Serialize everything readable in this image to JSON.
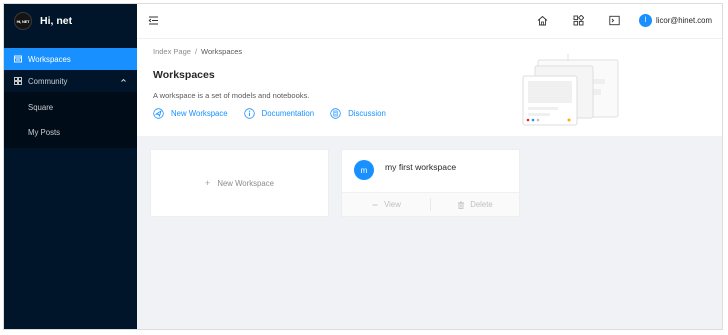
{
  "app": {
    "logo_badge": "Hi, NET",
    "logo_text": "Hi, net"
  },
  "sidebar": {
    "items": [
      {
        "label": "Workspaces",
        "icon": "workspace-icon",
        "active": true
      },
      {
        "label": "Community",
        "icon": "community-icon",
        "expanded": true,
        "children": [
          {
            "label": "Square"
          },
          {
            "label": "My Posts"
          }
        ]
      }
    ]
  },
  "header": {
    "icons": [
      "menu-fold-icon",
      "home-icon",
      "apps-icon",
      "terminal-icon"
    ],
    "user": {
      "avatar_letter": "l",
      "email": "licor@hinet.com"
    }
  },
  "page": {
    "breadcrumb": [
      "Index Page",
      "Workspaces"
    ],
    "title": "Workspaces",
    "description": "A workspace is a set of models and notebooks.",
    "links": [
      {
        "label": "New Workspace",
        "icon": "new-workspace-icon"
      },
      {
        "label": "Documentation",
        "icon": "info-icon"
      },
      {
        "label": "Discussion",
        "icon": "file-icon"
      }
    ]
  },
  "cards": {
    "new_workspace_label": "New Workspace",
    "new_workspace_plus": "+",
    "workspace": {
      "avatar_letter": "m",
      "name": "my first workspace",
      "view_label": "View",
      "delete_label": "Delete"
    }
  },
  "colors": {
    "primary": "#1890ff",
    "sidebar_bg": "#001529",
    "submenu_bg": "#000c17",
    "content_bg": "#f0f2f5"
  }
}
